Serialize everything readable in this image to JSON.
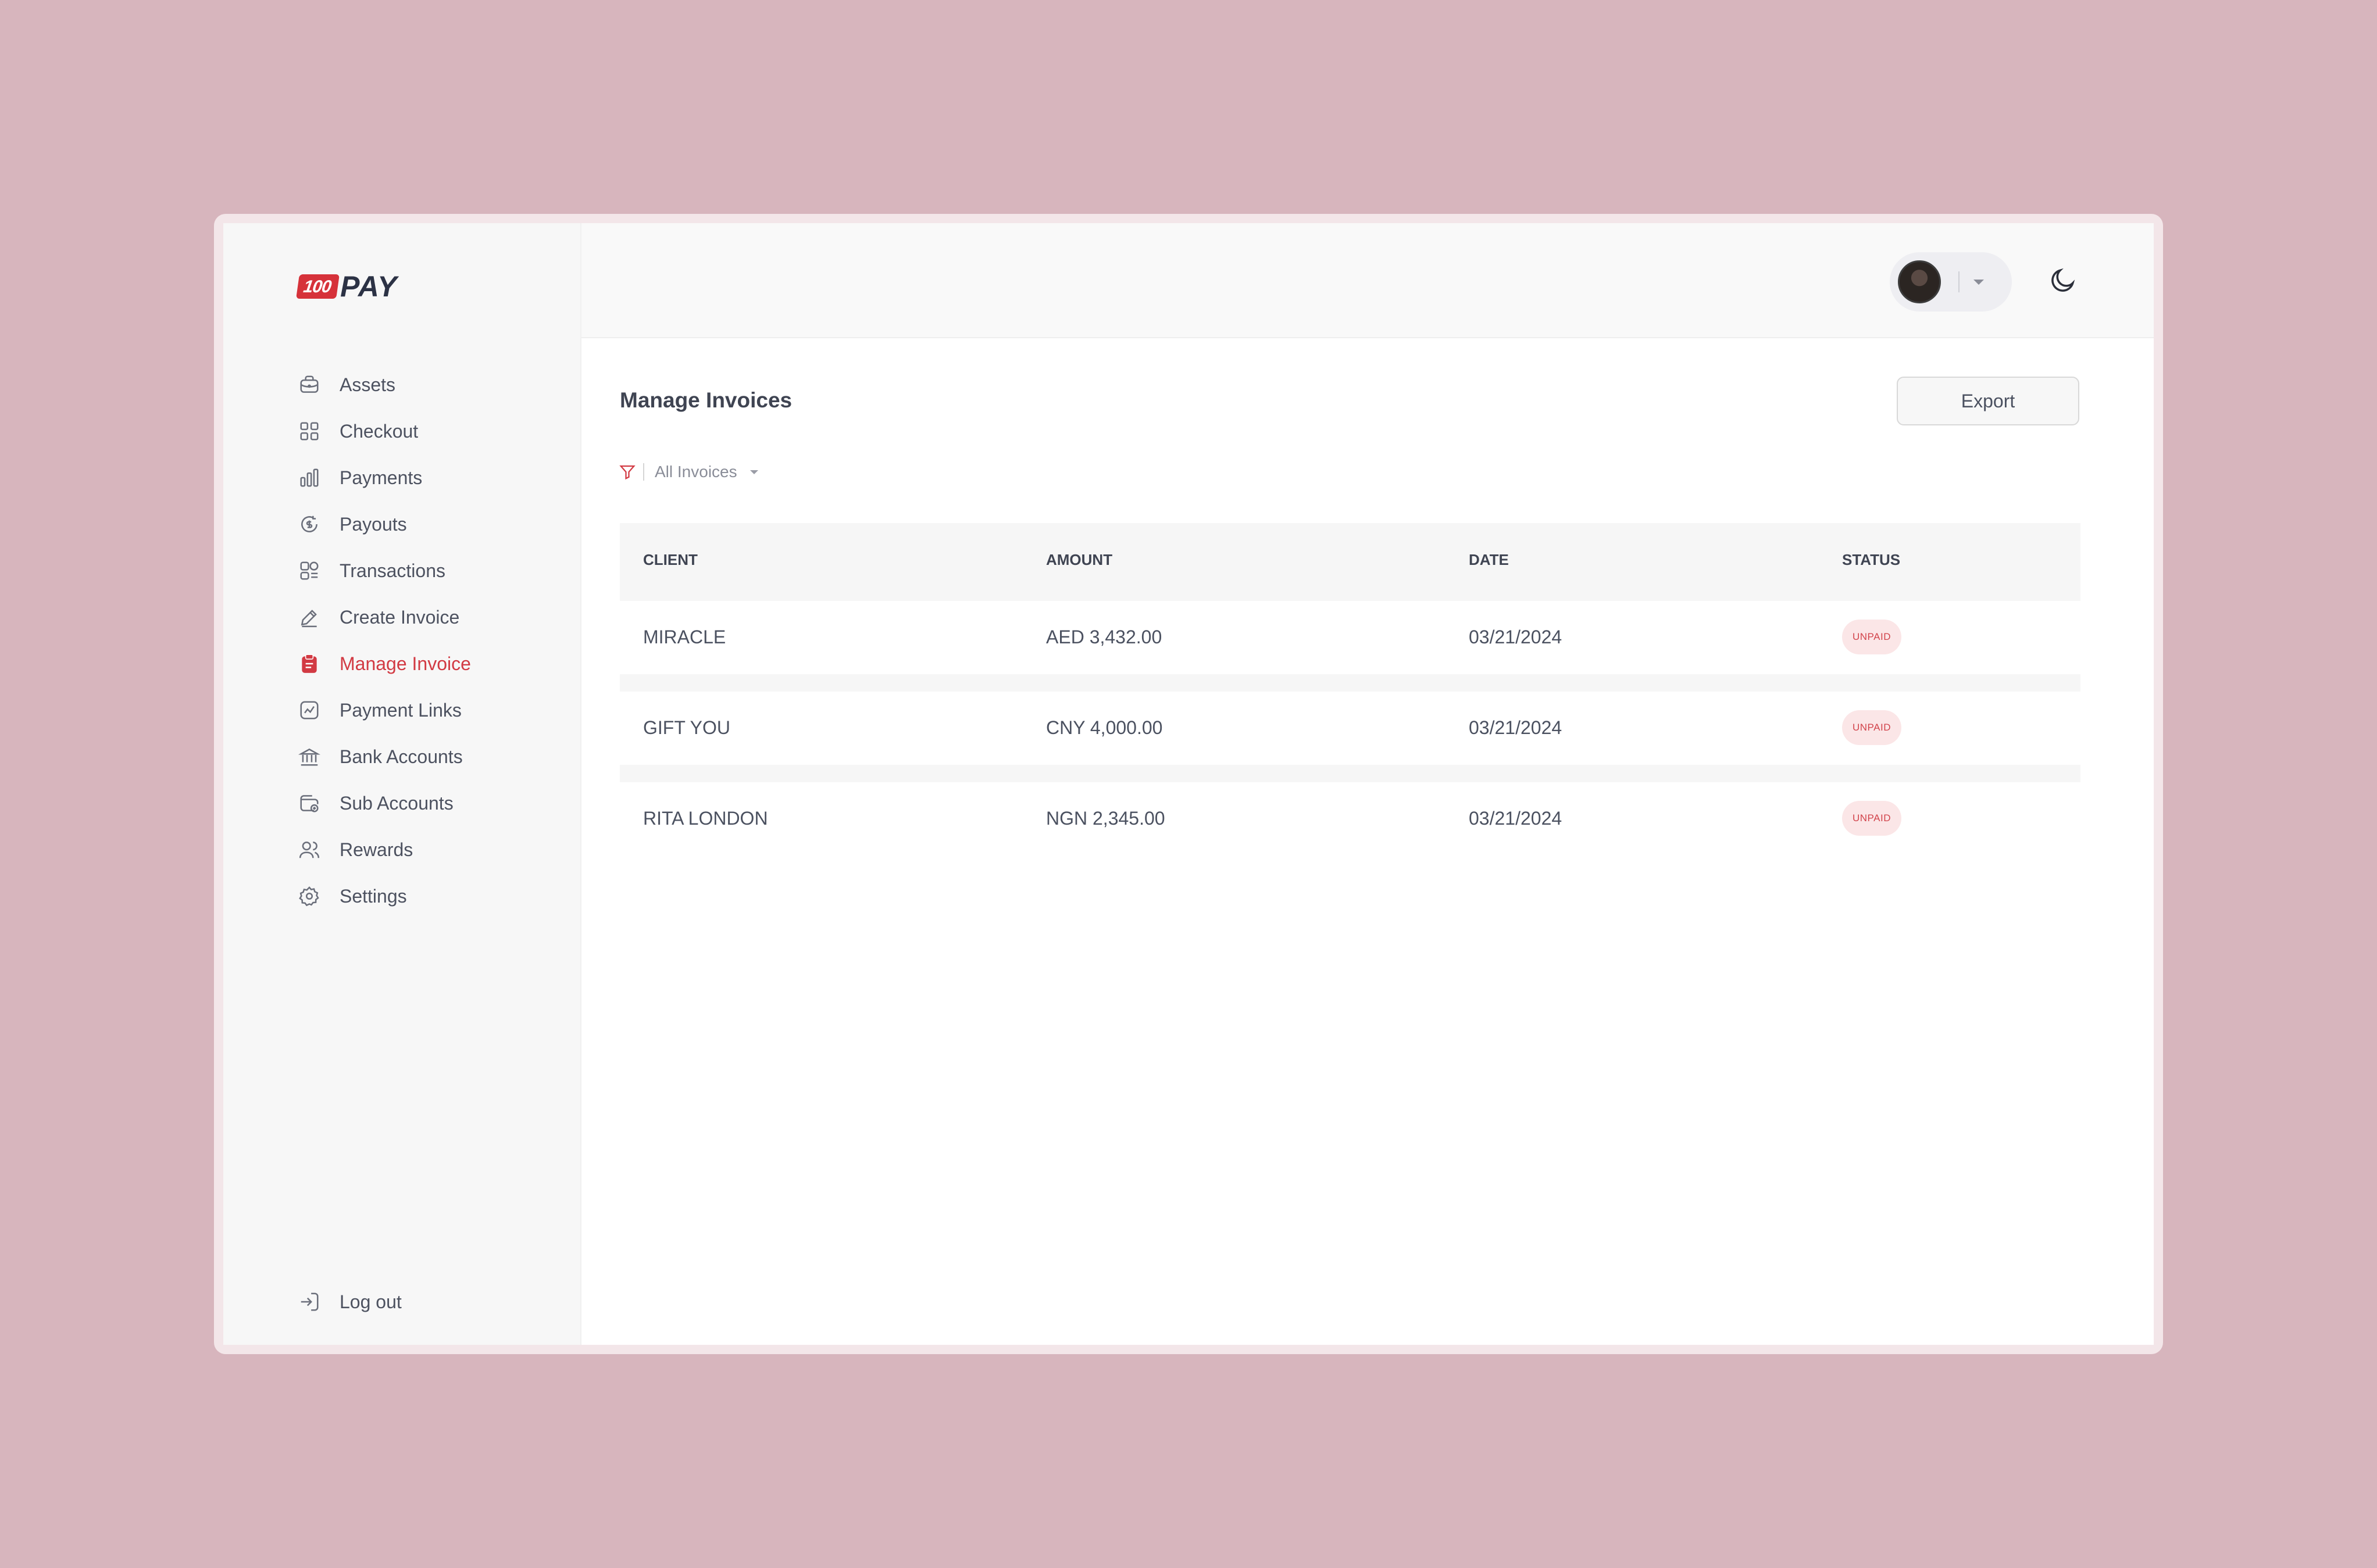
{
  "brand": {
    "logo_badge": "100",
    "logo_word": "PAY",
    "accent_color": "#d6323a"
  },
  "sidebar": {
    "items": [
      {
        "label": "Assets",
        "icon": "briefcase-icon"
      },
      {
        "label": "Checkout",
        "icon": "grid-icon"
      },
      {
        "label": "Payments",
        "icon": "bar-chart-icon"
      },
      {
        "label": "Payouts",
        "icon": "coin-refresh-icon"
      },
      {
        "label": "Transactions",
        "icon": "transactions-icon"
      },
      {
        "label": "Create Invoice",
        "icon": "pencil-icon"
      },
      {
        "label": "Manage Invoice",
        "icon": "clipboard-icon",
        "active": true
      },
      {
        "label": "Payment Links",
        "icon": "trend-chart-icon"
      },
      {
        "label": "Bank Accounts",
        "icon": "bank-icon"
      },
      {
        "label": "Sub Accounts",
        "icon": "wallet-icon"
      },
      {
        "label": "Rewards",
        "icon": "users-icon"
      },
      {
        "label": "Settings",
        "icon": "gear-icon"
      }
    ],
    "logout": {
      "label": "Log out",
      "icon": "logout-icon"
    }
  },
  "header": {
    "avatar": "user-avatar",
    "theme_icon": "moon-icon"
  },
  "main": {
    "title": "Manage Invoices",
    "export_label": "Export",
    "filter": {
      "icon": "filter-icon",
      "label": "All Invoices"
    },
    "table": {
      "columns": [
        "CLIENT",
        "AMOUNT",
        "DATE",
        "STATUS"
      ],
      "rows": [
        {
          "client": "MIRACLE",
          "amount": "AED 3,432.00",
          "date": "03/21/2024",
          "status": "UNPAID"
        },
        {
          "client": "GIFT YOU",
          "amount": "CNY 4,000.00",
          "date": "03/21/2024",
          "status": "UNPAID"
        },
        {
          "client": "RITA LONDON",
          "amount": "NGN 2,345.00",
          "date": "03/21/2024",
          "status": "UNPAID"
        }
      ]
    }
  }
}
